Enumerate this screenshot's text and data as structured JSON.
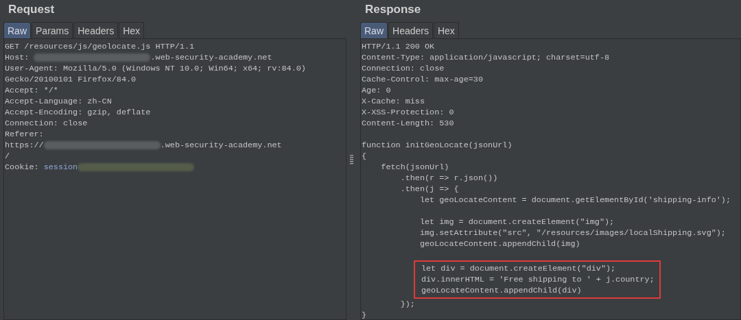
{
  "panels": [
    {
      "title": "Request",
      "tabs": [
        {
          "label": "Raw",
          "selected": true
        },
        {
          "label": "Params",
          "selected": false
        },
        {
          "label": "Headers",
          "selected": false
        },
        {
          "label": "Hex",
          "selected": false
        }
      ],
      "lines": [
        {
          "kind": "text",
          "highlighted": false,
          "parts": [
            {
              "kind": "plain",
              "text": "GET /resources/js/geolocate.js HTTP/1.1"
            }
          ]
        },
        {
          "kind": "text",
          "highlighted": false,
          "parts": [
            {
              "kind": "plain",
              "text": "Host: "
            },
            {
              "kind": "redacted",
              "color": "#5a5d60"
            },
            {
              "kind": "plain",
              "text": ".web-security-academy.net"
            }
          ]
        },
        {
          "kind": "text",
          "highlighted": false,
          "parts": [
            {
              "kind": "plain",
              "text": "User-Agent: Mozilla/5.0 (Windows NT 10.0; Win64; x64; rv:84.0)"
            }
          ]
        },
        {
          "kind": "text",
          "highlighted": false,
          "parts": [
            {
              "kind": "plain",
              "text": "Gecko/20100101 Firefox/84.0"
            }
          ]
        },
        {
          "kind": "text",
          "highlighted": false,
          "parts": [
            {
              "kind": "plain",
              "text": "Accept: */*"
            }
          ]
        },
        {
          "kind": "text",
          "highlighted": false,
          "parts": [
            {
              "kind": "plain",
              "text": "Accept-Language: zh-CN"
            }
          ]
        },
        {
          "kind": "text",
          "highlighted": false,
          "parts": [
            {
              "kind": "plain",
              "text": "Accept-Encoding: gzip, deflate"
            }
          ]
        },
        {
          "kind": "text",
          "highlighted": false,
          "parts": [
            {
              "kind": "plain",
              "text": "Connection: close"
            }
          ]
        },
        {
          "kind": "text",
          "highlighted": false,
          "parts": [
            {
              "kind": "plain",
              "text": "Referer:"
            }
          ]
        },
        {
          "kind": "text",
          "highlighted": false,
          "parts": [
            {
              "kind": "plain",
              "text": "https://"
            },
            {
              "kind": "redacted",
              "color": "#5a5d60"
            },
            {
              "kind": "plain",
              "text": ".web-security-academy.net"
            }
          ]
        },
        {
          "kind": "text",
          "highlighted": false,
          "parts": [
            {
              "kind": "plain",
              "text": "/"
            }
          ]
        },
        {
          "kind": "text",
          "highlighted": false,
          "parts": [
            {
              "kind": "plain",
              "text": "Cookie: "
            },
            {
              "kind": "param",
              "text": "session"
            },
            {
              "kind": "redacted",
              "color": "#545c4a"
            }
          ]
        }
      ]
    },
    {
      "title": "Response",
      "tabs": [
        {
          "label": "Raw",
          "selected": true
        },
        {
          "label": "Headers",
          "selected": false
        },
        {
          "label": "Hex",
          "selected": false
        }
      ],
      "lines": [
        {
          "kind": "text",
          "highlighted": false,
          "parts": [
            {
              "kind": "plain",
              "text": "HTTP/1.1 200 OK"
            }
          ]
        },
        {
          "kind": "text",
          "highlighted": false,
          "parts": [
            {
              "kind": "plain",
              "text": "Content-Type: application/javascript; charset=utf-8"
            }
          ]
        },
        {
          "kind": "text",
          "highlighted": false,
          "parts": [
            {
              "kind": "plain",
              "text": "Connection: close"
            }
          ]
        },
        {
          "kind": "text",
          "highlighted": false,
          "parts": [
            {
              "kind": "plain",
              "text": "Cache-Control: max-age=30"
            }
          ]
        },
        {
          "kind": "text",
          "highlighted": false,
          "parts": [
            {
              "kind": "plain",
              "text": "Age: 0"
            }
          ]
        },
        {
          "kind": "text",
          "highlighted": false,
          "parts": [
            {
              "kind": "plain",
              "text": "X-Cache: miss"
            }
          ]
        },
        {
          "kind": "text",
          "highlighted": false,
          "parts": [
            {
              "kind": "plain",
              "text": "X-XSS-Protection: 0"
            }
          ]
        },
        {
          "kind": "text",
          "highlighted": false,
          "parts": [
            {
              "kind": "plain",
              "text": "Content-Length: 530"
            }
          ]
        },
        {
          "kind": "blank",
          "highlighted": false
        },
        {
          "kind": "text",
          "highlighted": false,
          "parts": [
            {
              "kind": "plain",
              "text": "function initGeoLocate(jsonUrl)"
            }
          ]
        },
        {
          "kind": "text",
          "highlighted": false,
          "parts": [
            {
              "kind": "plain",
              "text": "{"
            }
          ]
        },
        {
          "kind": "text",
          "highlighted": false,
          "parts": [
            {
              "kind": "plain",
              "text": "    fetch(jsonUrl)"
            }
          ]
        },
        {
          "kind": "text",
          "highlighted": false,
          "parts": [
            {
              "kind": "plain",
              "text": "        .then(r => r.json())"
            }
          ]
        },
        {
          "kind": "text",
          "highlighted": false,
          "parts": [
            {
              "kind": "plain",
              "text": "        .then(j => {"
            }
          ]
        },
        {
          "kind": "text",
          "highlighted": false,
          "parts": [
            {
              "kind": "plain",
              "text": "            let geoLocateContent = document.getElementById('shipping-info');"
            }
          ]
        },
        {
          "kind": "blank",
          "highlighted": false
        },
        {
          "kind": "text",
          "highlighted": false,
          "parts": [
            {
              "kind": "plain",
              "text": "            let img = document.createElement(\"img\");"
            }
          ]
        },
        {
          "kind": "text",
          "highlighted": false,
          "parts": [
            {
              "kind": "plain",
              "text": "            img.setAttribute(\"src\", \"/resources/images/localShipping.svg\");"
            }
          ]
        },
        {
          "kind": "text",
          "highlighted": false,
          "parts": [
            {
              "kind": "plain",
              "text": "            geoLocateContent.appendChild(img)"
            }
          ]
        },
        {
          "kind": "blank",
          "highlighted": false
        },
        {
          "kind": "text",
          "highlighted": true,
          "parts": [
            {
              "kind": "plain",
              "text": "            let div = document.createElement(\"div\");"
            }
          ]
        },
        {
          "kind": "text",
          "highlighted": true,
          "parts": [
            {
              "kind": "plain",
              "text": "            div.innerHTML = 'Free shipping to ' + j.country;"
            }
          ]
        },
        {
          "kind": "text",
          "highlighted": true,
          "parts": [
            {
              "kind": "plain",
              "text": "            geoLocateContent.appendChild(div)"
            }
          ]
        },
        {
          "kind": "text",
          "highlighted": false,
          "parts": [
            {
              "kind": "plain",
              "text": "        });"
            }
          ]
        },
        {
          "kind": "text",
          "highlighted": false,
          "parts": [
            {
              "kind": "plain",
              "text": "}"
            }
          ]
        }
      ]
    }
  ]
}
